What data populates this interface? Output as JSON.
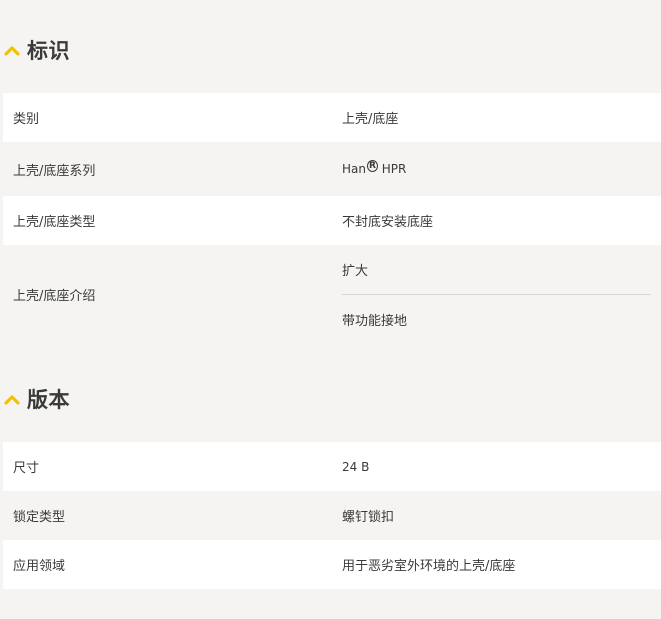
{
  "section1": {
    "title": "标识",
    "rows": [
      {
        "label": "类别",
        "value": "上壳/底座"
      },
      {
        "label": "上壳/底座系列",
        "value_main": "Han",
        "value_reg": "R",
        "value_rest": " HPR"
      },
      {
        "label": "上壳/底座类型",
        "value": "不封底安装底座"
      },
      {
        "label": "上壳/底座介绍",
        "values": [
          "扩大",
          "带功能接地"
        ]
      }
    ]
  },
  "section2": {
    "title": "版本",
    "rows": [
      {
        "label": "尺寸",
        "value": "24 B"
      },
      {
        "label": "锁定类型",
        "value": "螺钉锁扣"
      },
      {
        "label": "应用领域",
        "value": "用于恶劣室外环境的上壳/底座"
      }
    ]
  },
  "colors": {
    "accent": "#f2c200",
    "row_white": "#ffffff",
    "row_grey": "#f5f4f2",
    "text": "#3a3a3a"
  }
}
